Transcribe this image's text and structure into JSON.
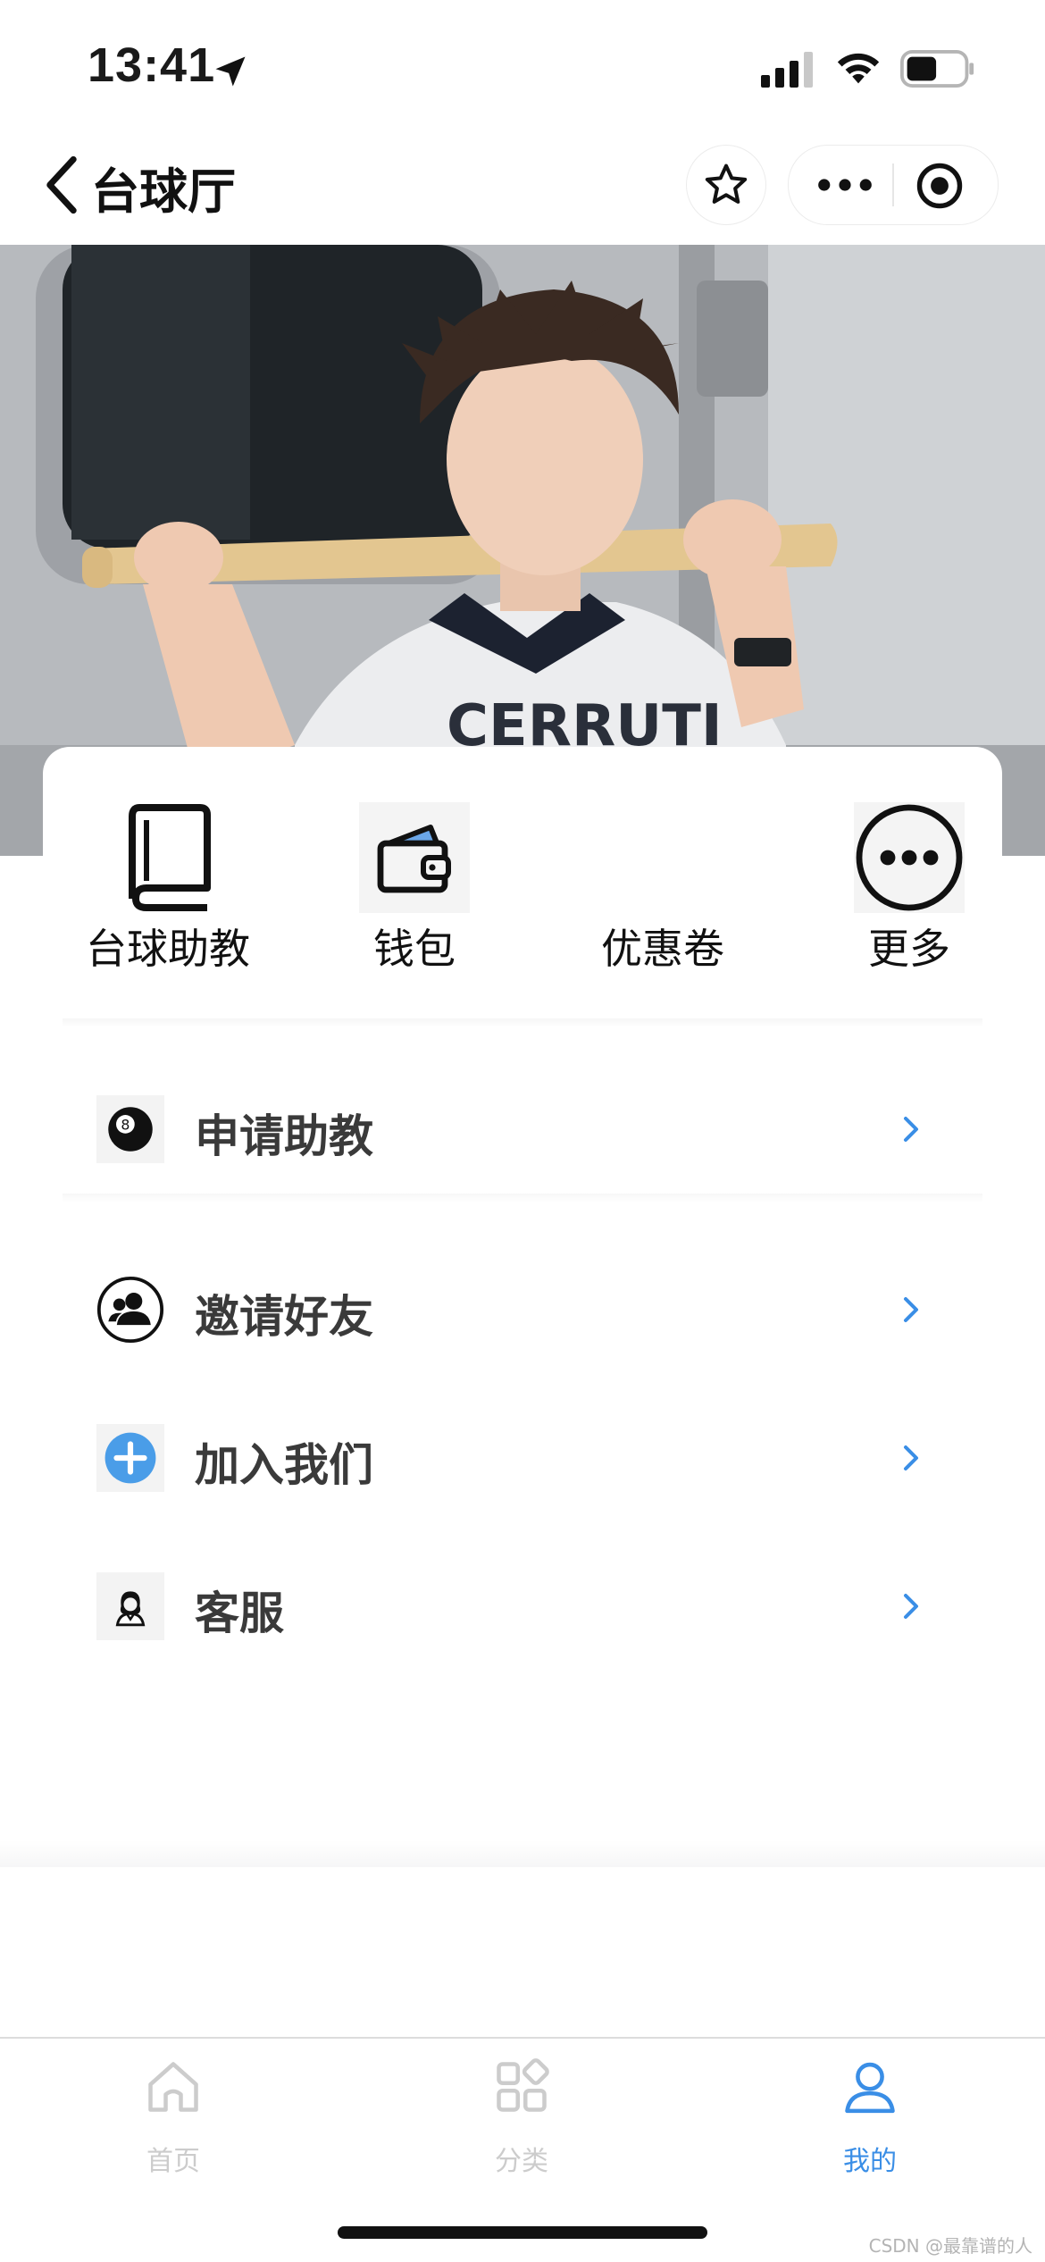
{
  "status_bar": {
    "time": "13:41",
    "icons": [
      "location-arrow-icon",
      "cellular-signal-icon",
      "wifi-icon",
      "battery-icon"
    ]
  },
  "nav": {
    "title": "台球厅",
    "icons": [
      "back-chevron-icon",
      "star-icon",
      "more-dots-icon",
      "target-icon"
    ]
  },
  "quick_menu": [
    {
      "label": "台球助教",
      "icon": "book-icon"
    },
    {
      "label": "钱包",
      "icon": "wallet-icon"
    },
    {
      "label": "优惠卷",
      "icon": ""
    },
    {
      "label": "更多",
      "icon": "more-circle-icon"
    }
  ],
  "list": [
    {
      "label": "申请助教",
      "icon": "billiard-ball-icon"
    },
    {
      "label": "邀请好友",
      "icon": "friends-icon"
    },
    {
      "label": "加入我们",
      "icon": "plus-circle-icon"
    },
    {
      "label": "客服",
      "icon": "customer-service-icon"
    }
  ],
  "tabs": [
    {
      "label": "首页",
      "icon": "home-icon",
      "active": false
    },
    {
      "label": "分类",
      "icon": "category-icon",
      "active": false
    },
    {
      "label": "我的",
      "icon": "user-icon",
      "active": true
    }
  ],
  "colors": {
    "accent": "#3a8ee6",
    "tab_inactive": "#cccccc",
    "chevron": "#3a8ee6",
    "plus_icon": "#4a9de8"
  },
  "watermark": "CSDN @最靠谱的人"
}
